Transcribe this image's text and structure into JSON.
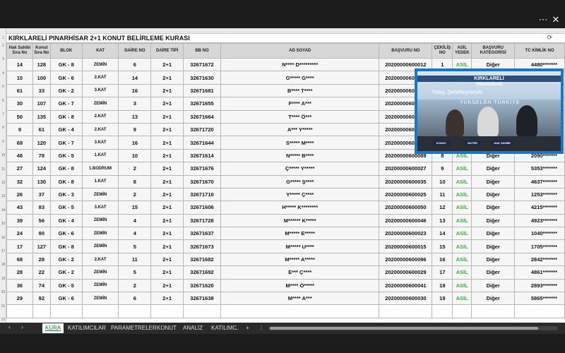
{
  "window": {
    "menu_icon": "⋯",
    "close_icon": "✕"
  },
  "sheet": {
    "title": "KIRKLARELİ PINARHİSAR 2+1 KONUT BELİRLEME KURASI",
    "headers": [
      "Hak Sahibi Sıra No",
      "Konut Sıra No",
      "BLOK",
      "KAT",
      "DAİRE NO",
      "DAİRE TİPİ",
      "BB NO",
      "AD SOYAD",
      "BAŞVURU NO",
      "ÇEKİLİŞ NO",
      "ASİL YEDEK",
      "BAŞVURU KATEGORİSİ",
      "TC KİMLİK NO"
    ],
    "rows": [
      [
        "14",
        "128",
        "GK - 8",
        "ZEMİN",
        "6",
        "2+1",
        "32671672",
        "N**** D*********",
        "20200000600012",
        "1",
        "ASİL",
        "Diğer",
        "4480*******"
      ],
      [
        "10",
        "100",
        "GK - 6",
        "2.KAT",
        "14",
        "2+1",
        "32671630",
        "G***** G****",
        "20200000600002",
        "2",
        "ASİL",
        "Diğer",
        "2570*******"
      ],
      [
        "61",
        "33",
        "GK - 2",
        "3.KAT",
        "16",
        "2+1",
        "32671681",
        "B**** T****",
        "20200000600073",
        "3",
        "ASİL",
        "Diğer",
        "1470*******"
      ],
      [
        "30",
        "107",
        "GK - 7",
        "ZEMİN",
        "3",
        "2+1",
        "32671655",
        "F**** A***",
        "20200000600064",
        "4",
        "ASİL",
        "Diğer",
        "3880*******"
      ],
      [
        "50",
        "135",
        "GK - 8",
        "2.KAT",
        "13",
        "2+1",
        "32671664",
        "T**** Ö***",
        "20200000600059",
        "5",
        "ASİL",
        "Diğer",
        "1190*******"
      ],
      [
        "9",
        "61",
        "GK - 4",
        "2.KAT",
        "9",
        "2+1",
        "32671720",
        "A*** Y*****",
        "20200000600054",
        "6",
        "ASİL",
        "Diğer",
        "2730*******"
      ],
      [
        "69",
        "120",
        "GK - 7",
        "3.KAT",
        "16",
        "2+1",
        "32671644",
        "S***** M****",
        "20200000600080",
        "7",
        "ASİL",
        "Diğer",
        "5870*******"
      ],
      [
        "48",
        "78",
        "GK - 5",
        "1.KAT",
        "10",
        "2+1",
        "32671614",
        "N***** B****",
        "20200000600089",
        "8",
        "ASİL",
        "Diğer",
        "2090*******"
      ],
      [
        "27",
        "124",
        "GK - 8",
        "1.BODRUM",
        "2",
        "2+1",
        "32671676",
        "Ç***** Y*****",
        "20200000600027",
        "9",
        "ASİL",
        "Diğer",
        "5353*******"
      ],
      [
        "32",
        "130",
        "GK - 8",
        "1.KAT",
        "8",
        "2+1",
        "32671670",
        "G***** Ş****",
        "20200000600035",
        "10",
        "ASİL",
        "Diğer",
        "4637*******"
      ],
      [
        "26",
        "37",
        "GK - 3",
        "ZEMİN",
        "2",
        "2+1",
        "32671710",
        "Y***** Ç****",
        "20200000600025",
        "11",
        "ASİL",
        "Diğer",
        "1253*******"
      ],
      [
        "43",
        "83",
        "GK - 5",
        "3.KAT",
        "15",
        "2+1",
        "32671606",
        "H***** K********",
        "20200000600050",
        "12",
        "ASİL",
        "Diğer",
        "4215*******"
      ],
      [
        "39",
        "56",
        "GK - 4",
        "ZEMİN",
        "4",
        "2+1",
        "32671728",
        "M****** K*****",
        "20200000600046",
        "13",
        "ASİL",
        "Diğer",
        "4923*******"
      ],
      [
        "24",
        "90",
        "GK - 6",
        "ZEMİN",
        "4",
        "2+1",
        "32671637",
        "M***** E*****",
        "20200000600023",
        "14",
        "ASİL",
        "Diğer",
        "1040*******"
      ],
      [
        "17",
        "127",
        "GK - 8",
        "ZEMİN",
        "5",
        "2+1",
        "32671673",
        "M***** U****",
        "20200000600015",
        "15",
        "ASİL",
        "Diğer",
        "1705*******"
      ],
      [
        "68",
        "28",
        "GK - 2",
        "2.KAT",
        "11",
        "2+1",
        "32671682",
        "M***** A*****",
        "20200000600086",
        "16",
        "ASİL",
        "Diğer",
        "2842*******"
      ],
      [
        "28",
        "22",
        "GK - 2",
        "ZEMİN",
        "5",
        "2+1",
        "32671692",
        "E*** Ç****",
        "20200000600029",
        "17",
        "ASİL",
        "Diğer",
        "4861*******"
      ],
      [
        "36",
        "74",
        "GK - 5",
        "ZEMİN",
        "2",
        "2+1",
        "32671620",
        "M**** Ö*****",
        "20200000600041",
        "18",
        "ASİL",
        "Diğer",
        "2893*******"
      ],
      [
        "29",
        "92",
        "GK - 6",
        "ZEMİN",
        "6",
        "2+1",
        "32671638",
        "M**** A***",
        "20200000600030",
        "19",
        "ASİL",
        "Diğer",
        "5865*******"
      ]
    ]
  },
  "tabs": {
    "kura": "KURA",
    "katilimcilar": "KATILIMCILAR",
    "parametreler": "PARAMETRELER",
    "konut": "KONUT",
    "analiz": "ANALİZ",
    "katilimc": "KATILIMC",
    "more": "...",
    "add": "+",
    "menu": "⋮"
  },
  "video": {
    "banner_line1": "KIRKLARELİ",
    "banner_line2": "PINARHİSAR",
    "banner_line3": "Yatay Şehirleşmeyle",
    "banner_line4": "YÜKSELEN TÜRKİYE",
    "plate_left": "KONUT",
    "plate_mid": "NOTER",
    "plate_right": "HAK SAHİBİ"
  },
  "colors": {
    "accent_frame": "#1778c9",
    "asil_green": "#3fae3b",
    "active_tab_text": "#1d6f33"
  }
}
